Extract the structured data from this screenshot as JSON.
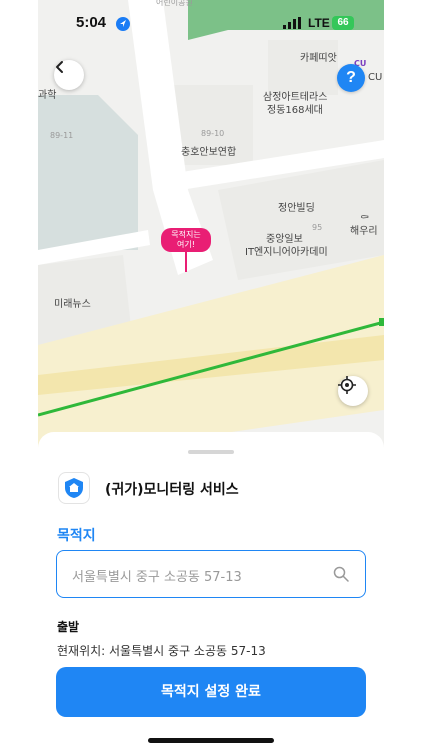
{
  "status_bar": {
    "time": "5:04",
    "network": "LTE",
    "battery": "66"
  },
  "map": {
    "labels": {
      "top_partial": "어린이공원",
      "cafe": "카페띠앗",
      "cu_logo": "CU",
      "cu_name": "CU",
      "apt_line1": "삼정아트테라스",
      "apt_line2": "정동168세대",
      "science": "과학",
      "num_89_11": "89-11",
      "num_89_10": "89-10",
      "chunghoan": "충호안보연합",
      "jeongan": "정안빌딩",
      "num_95": "95",
      "haewoori": "해우리",
      "joongang_line1": "중앙일보",
      "joongang_line2": "IT엔지니어아카데미",
      "mirae": "미래뉴스"
    },
    "pin": {
      "line1": "목적지는",
      "line2": "여기!"
    },
    "colors": {
      "route": "#2fb83a",
      "pin": "#e91e74",
      "road": "#f7f0cf",
      "park": "#7cc188"
    }
  },
  "sheet": {
    "service_title": "(귀가)모니터링 서비스",
    "destination_label": "목적지",
    "destination_value": "서울특별시 중구 소공동 57-13",
    "departure_label": "출발",
    "current_location": "현재위치: 서울특별시 중구 소공동 57-13",
    "confirm_button": "목적지 설정 완료"
  },
  "icons": [
    "location-arrow-icon",
    "signal-icon",
    "back-chevron-icon",
    "help-icon",
    "current-location-icon",
    "shield-home-icon",
    "search-icon"
  ],
  "accent_color": "#1f86f4"
}
